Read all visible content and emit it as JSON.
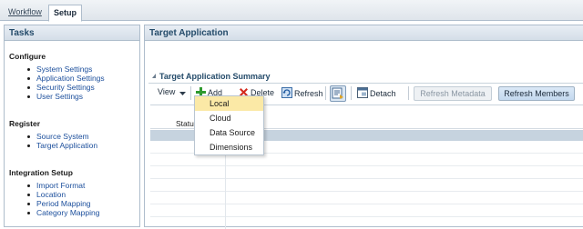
{
  "top_tabs": [
    {
      "label": "Workflow",
      "active": false
    },
    {
      "label": "Setup",
      "active": true
    }
  ],
  "tasks_panel": {
    "title": "Tasks",
    "sections": [
      {
        "title": "Configure",
        "links": [
          "System Settings",
          "Application Settings",
          "Security Settings",
          "User Settings"
        ]
      },
      {
        "title": "Register",
        "links": [
          "Source System",
          "Target Application"
        ]
      },
      {
        "title": "Integration Setup",
        "links": [
          "Import Format",
          "Location",
          "Period Mapping",
          "Category Mapping"
        ]
      }
    ]
  },
  "main_panel": {
    "title": "Target Application",
    "summary_title": "Target Application Summary",
    "toolbar": {
      "view": "View",
      "add": "Add",
      "delete": "Delete",
      "refresh": "Refresh",
      "detach": "Detach",
      "refresh_metadata": "Refresh Metadata",
      "refresh_members": "Refresh Members"
    },
    "table": {
      "columns": [
        "Status"
      ]
    },
    "add_menu": [
      "Local",
      "Cloud",
      "Data Source",
      "Dimensions"
    ],
    "highlighted_menu_item": "Local"
  },
  "colors": {
    "accent": "#244b6a",
    "link": "#1c4f9c",
    "highlight": "#fbe9a6",
    "selection": "#c6d3df"
  },
  "icons": [
    "add-icon",
    "delete-icon",
    "refresh-icon",
    "export-icon",
    "detach-icon",
    "view-dropdown-icon"
  ]
}
